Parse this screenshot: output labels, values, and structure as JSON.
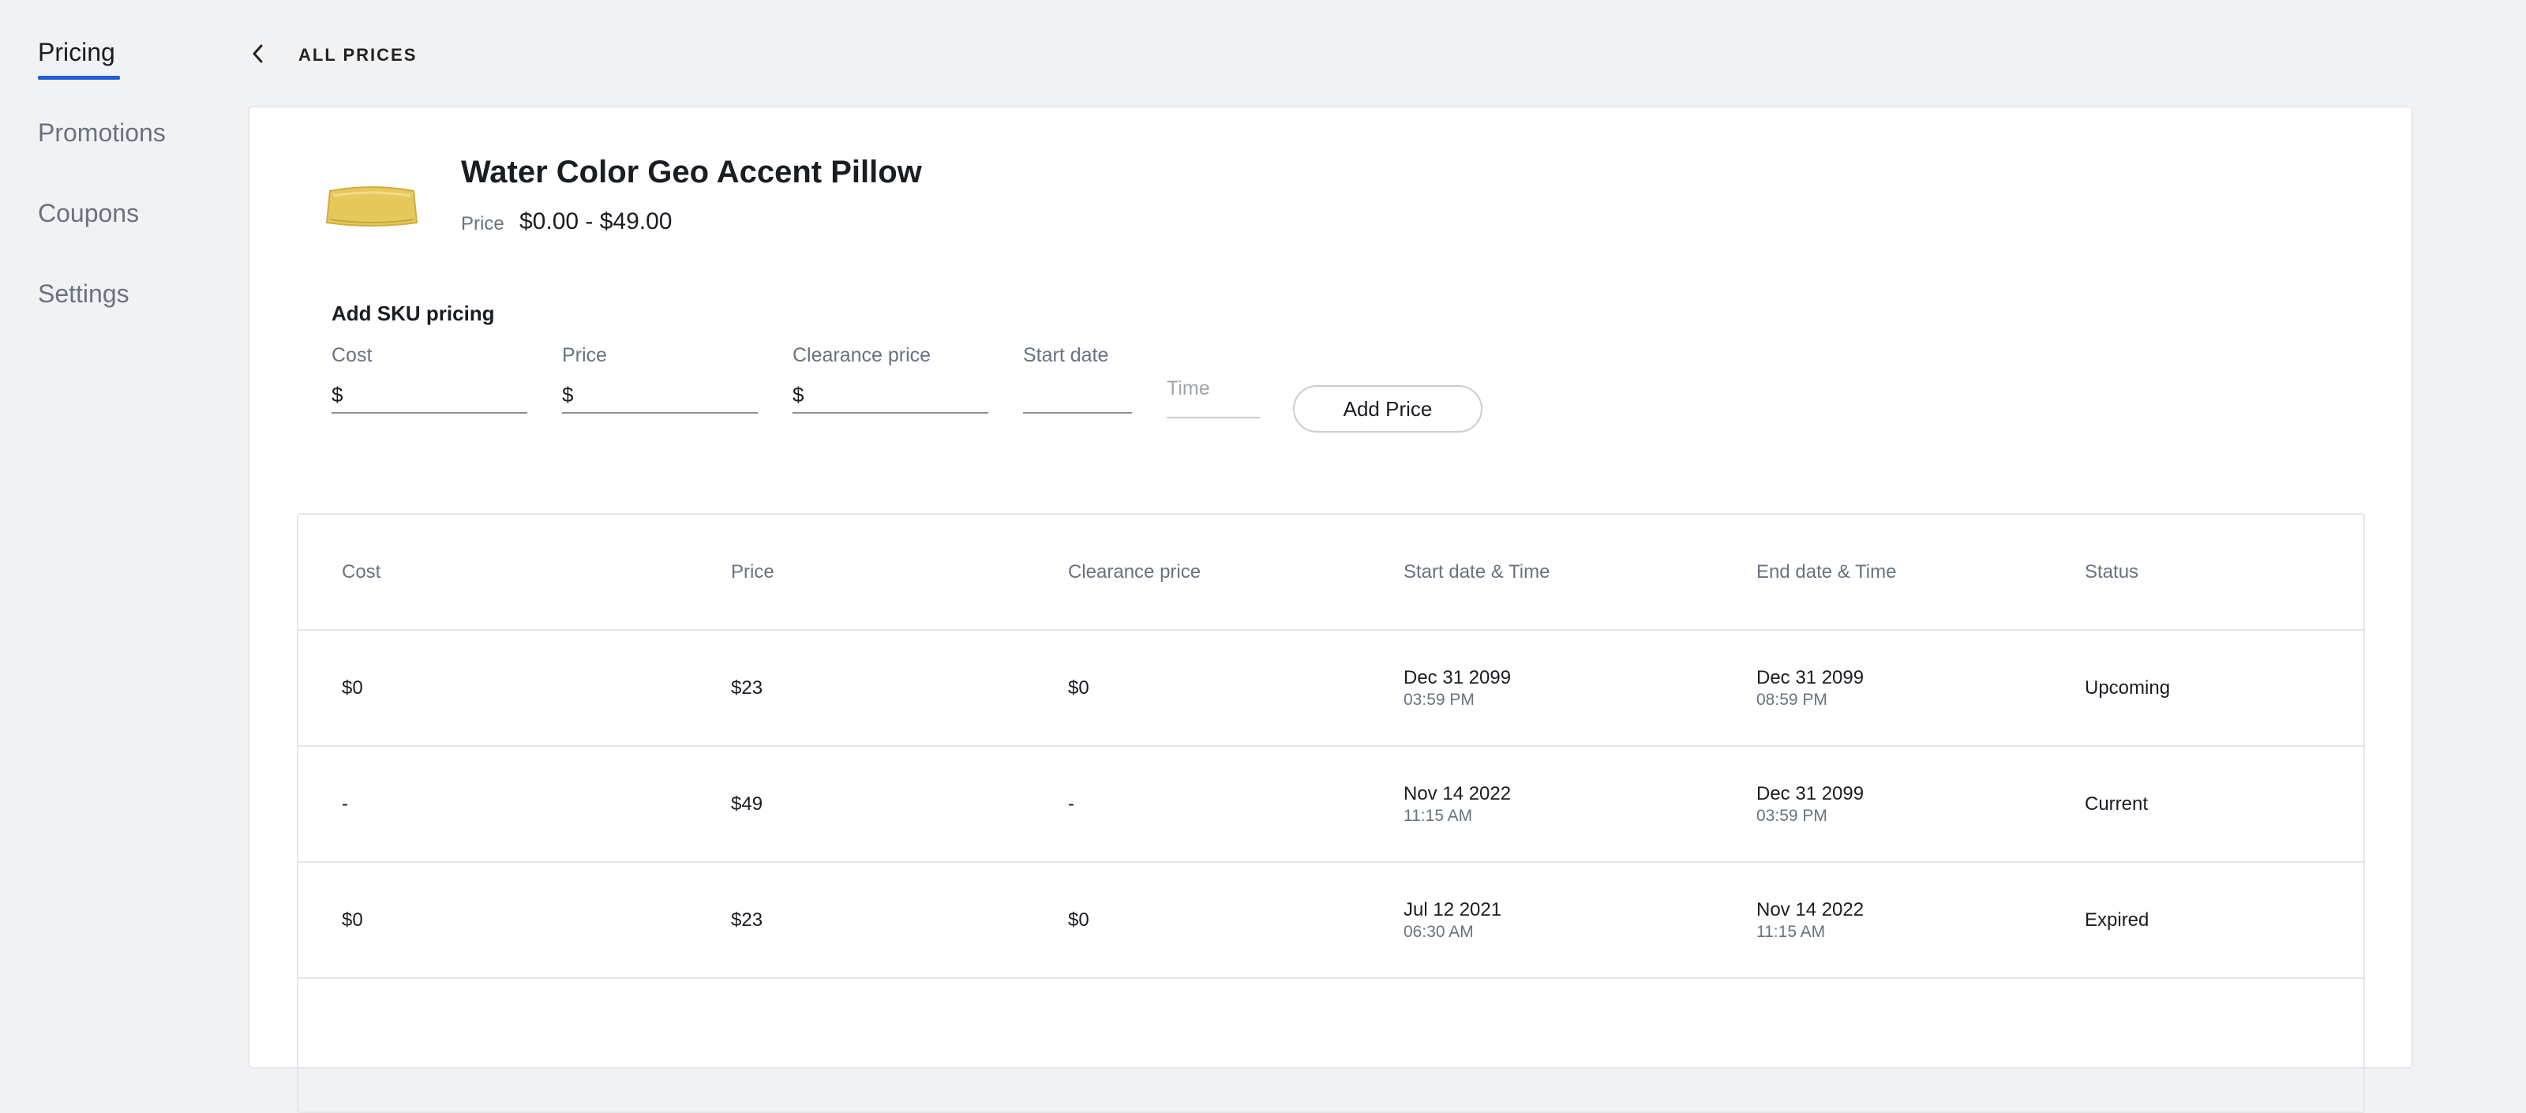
{
  "sidebar": {
    "items": [
      {
        "label": "Pricing",
        "active": true
      },
      {
        "label": "Promotions",
        "active": false
      },
      {
        "label": "Coupons",
        "active": false
      },
      {
        "label": "Settings",
        "active": false
      }
    ]
  },
  "back_link": {
    "label": "ALL PRICES"
  },
  "product": {
    "title": "Water Color Geo Accent Pillow",
    "price_label": "Price",
    "price_range": "$0.00 - $49.00"
  },
  "sku_form": {
    "heading": "Add SKU pricing",
    "cost": {
      "label": "Cost",
      "value": "$"
    },
    "price": {
      "label": "Price",
      "value": "$"
    },
    "clearance": {
      "label": "Clearance price",
      "value": "$"
    },
    "start_date": {
      "label": "Start date",
      "value": ""
    },
    "time": {
      "placeholder": "Time"
    },
    "add_button": "Add Price"
  },
  "table": {
    "headers": [
      "Cost",
      "Price",
      "Clearance price",
      "Start date & Time",
      "End date & Time",
      "Status"
    ],
    "rows": [
      {
        "cost": "$0",
        "price": "$23",
        "clearance": "$0",
        "start_date": "Dec 31 2099",
        "start_time": "03:59 PM",
        "end_date": "Dec 31 2099",
        "end_time": "08:59 PM",
        "status": "Upcoming"
      },
      {
        "cost": "-",
        "price": "$49",
        "clearance": "-",
        "start_date": "Nov 14 2022",
        "start_time": "11:15 AM",
        "end_date": "Dec 31 2099",
        "end_time": "03:59 PM",
        "status": "Current"
      },
      {
        "cost": "$0",
        "price": "$23",
        "clearance": "$0",
        "start_date": "Jul 12 2021",
        "start_time": "06:30 AM",
        "end_date": "Nov 14 2022",
        "end_time": "11:15 AM",
        "status": "Expired"
      }
    ]
  },
  "colors": {
    "accent": "#1f5fd6",
    "background": "#f1f2f4",
    "pillow": "#e8c85a"
  }
}
